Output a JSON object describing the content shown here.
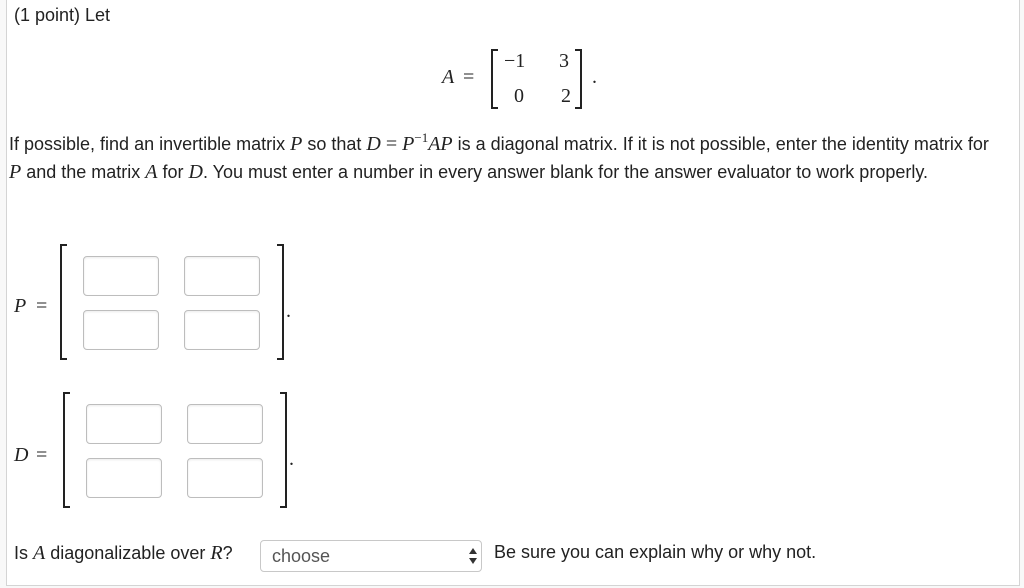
{
  "problem": {
    "header": "(1 point) Let",
    "matrix_A": {
      "name": "A",
      "equals": "=",
      "rows": [
        [
          "−1",
          "3"
        ],
        [
          "0",
          "2"
        ]
      ],
      "trailing": "."
    },
    "instructions": {
      "t1": "If possible, find an invertible matrix ",
      "P": "P",
      "t2": " so that ",
      "D": "D",
      "eq": " = ",
      "P2": "P",
      "exp": "−1",
      "AP": "AP",
      "t3": " is a diagonal matrix. If it is not possible, enter the identity matrix for ",
      "P3": "P",
      "t4": " and the matrix ",
      "A": "A",
      "t5": " for ",
      "D2": "D",
      "t6": ". You must enter a number in every answer blank for the answer evaluator to work properly."
    },
    "matrix_P": {
      "label": "P",
      "equals": "=",
      "cells": [
        "",
        "",
        "",
        ""
      ],
      "trailing": "."
    },
    "matrix_D": {
      "label": "D",
      "equals": "=",
      "cells": [
        "",
        "",
        "",
        ""
      ],
      "trailing": "."
    },
    "question": {
      "t1": "Is ",
      "A": "A",
      "t2": " diagonalizable over ",
      "R": "R",
      "t3": "?",
      "select_value": "choose",
      "after": "Be sure you can explain why or why not."
    }
  }
}
